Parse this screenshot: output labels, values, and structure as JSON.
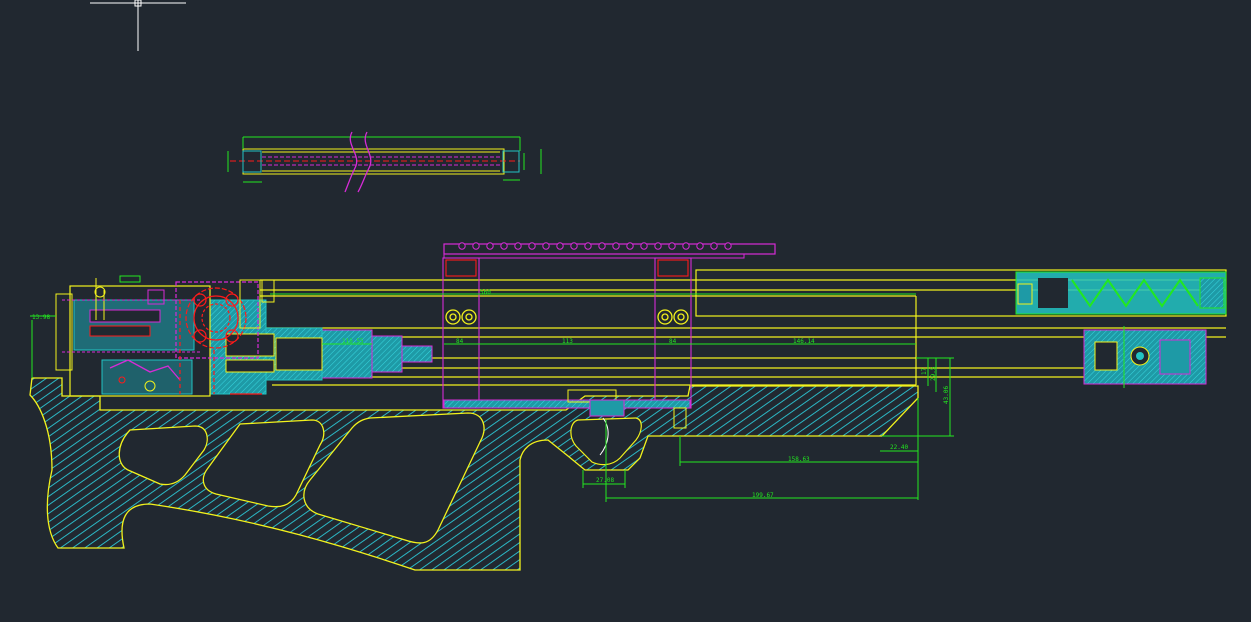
{
  "app": {
    "type": "cad-model-space",
    "theme": "dark",
    "background": "#212830"
  },
  "colors": {
    "yellow": "#f2f21c",
    "green": "#22e81f",
    "cyan": "#22c3c3",
    "magenta": "#d62bd6",
    "red": "#ff1a1a",
    "white": "#ffffff",
    "hatch": "#2bb7c4"
  },
  "cursor": {
    "icon": "crosshair-cursor-icon"
  },
  "drawings": {
    "barrel_detail": {
      "name": "barrel-detail-view"
    },
    "rifle_assembly": {
      "name": "rifle-assembly-section"
    }
  },
  "dimensions": {
    "d_13_98": "13.98",
    "d_560": "560",
    "d_84_left": "84",
    "d_113": "113",
    "d_84_right": "84",
    "d_146_14": "146.14",
    "d_116_55": "116.55",
    "d_17": "17",
    "d_29_5": "29.5",
    "d_43_06": "43.06",
    "d_22_40": "22.40",
    "d_158_63": "158.63",
    "d_27_08": "27.08",
    "d_199_67": "199.67"
  }
}
